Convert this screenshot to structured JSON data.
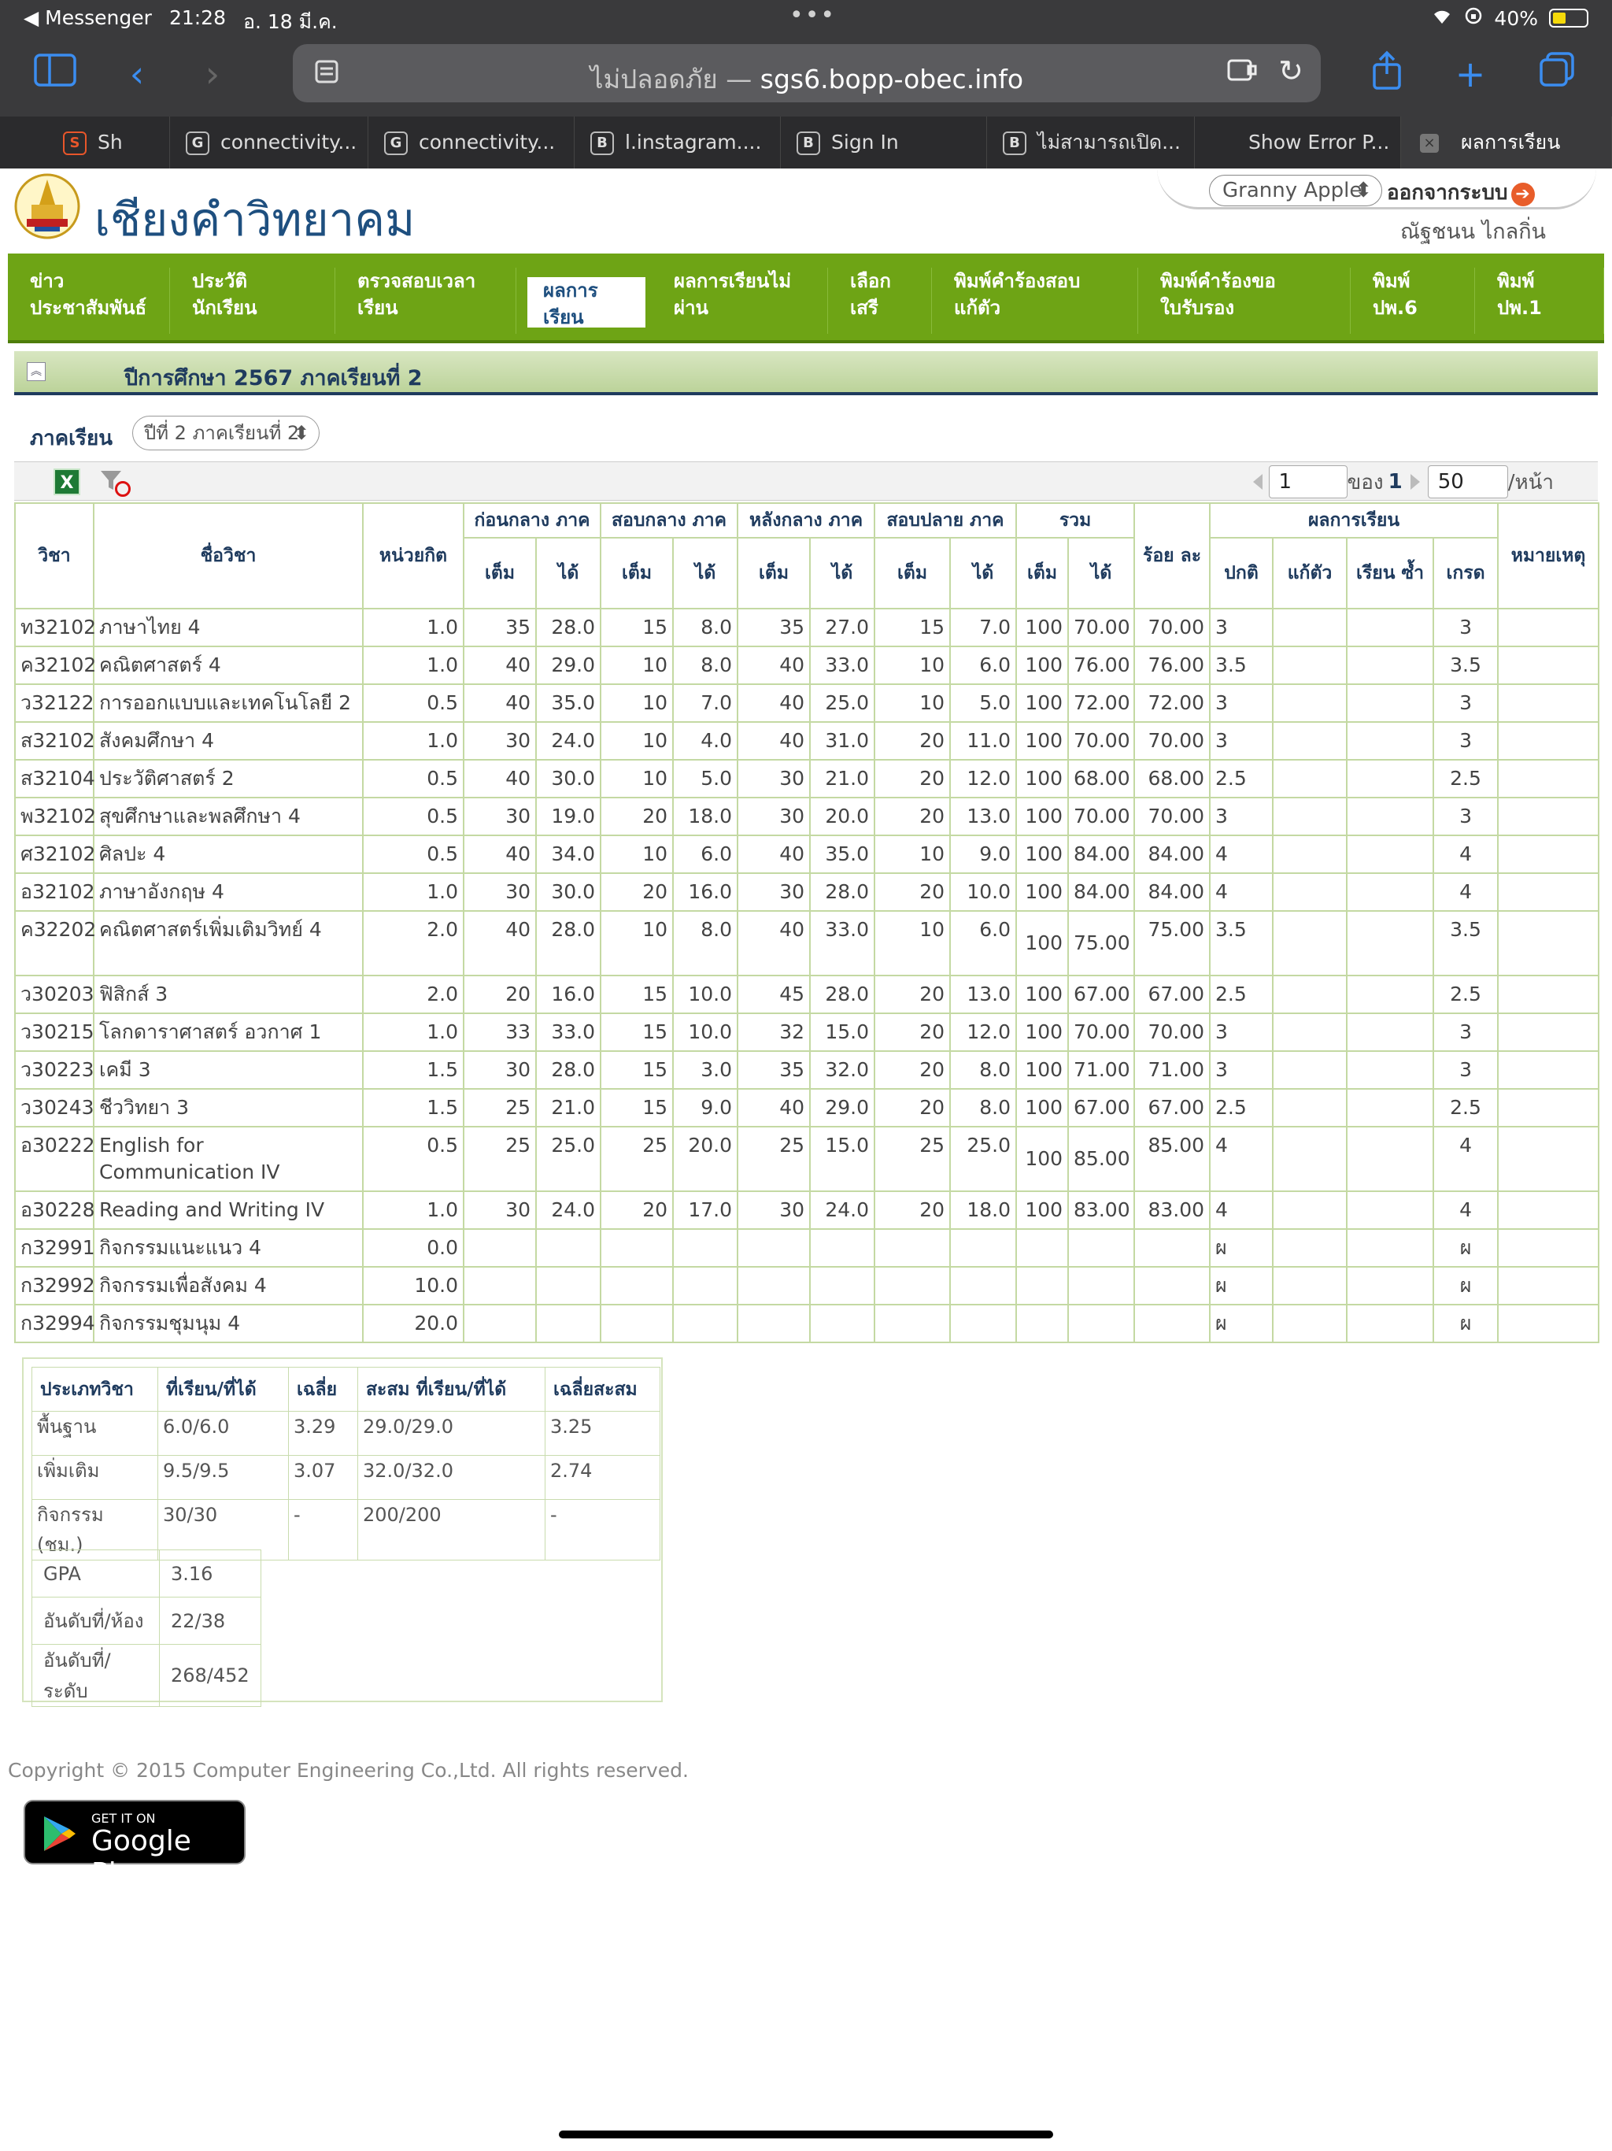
{
  "status_bar": {
    "back_app": "◀ Messenger",
    "time": "21:28",
    "date": "อ. 18 มี.ค.",
    "dots": "•••",
    "battery": "40%"
  },
  "browser": {
    "url_prefix": "ไม่ปลอดภัย — ",
    "url_host": "sgs6.bopp-obec.info",
    "tabs": [
      {
        "fav": "G",
        "label": "connectivity..."
      },
      {
        "fav": "G",
        "label": "connectivity..."
      },
      {
        "fav": "B",
        "label": "l.instagram...."
      },
      {
        "fav": "B",
        "label": "Sign In"
      },
      {
        "fav": "B",
        "label": "ไม่สามารถเปิด..."
      },
      {
        "fav": "",
        "label": "Show Error P..."
      },
      {
        "fav": "×",
        "label": "ผลการเรียน"
      }
    ],
    "first_tab_label": "Sh"
  },
  "site": {
    "title": "เชียงคำวิทยาคม",
    "user_select": "Granny Apple",
    "logout": "ออกจากระบบ",
    "user_name": "ณัฐชนน ไกลกิ่น"
  },
  "nav": [
    {
      "l1": "ข่าว",
      "l2": "ประชาสัมพันธ์"
    },
    {
      "l1": "ประวัติ",
      "l2": "นักเรียน"
    },
    {
      "l1": "ตรวจสอบเวลา",
      "l2": "เรียน"
    },
    {
      "l1": "ผลการ",
      "l2": "เรียน"
    },
    {
      "l1": "ผลการเรียนไม่",
      "l2": "ผ่าน"
    },
    {
      "l1": "เลือก",
      "l2": "เสรี"
    },
    {
      "l1": "พิมพ์คำร้องสอบ",
      "l2": "แก้ตัว"
    },
    {
      "l1": "พิมพ์คำร้องขอ",
      "l2": "ใบรับรอง"
    },
    {
      "l1": "พิมพ์",
      "l2": "ปพ.6"
    },
    {
      "l1": "พิมพ์",
      "l2": "ปพ.1"
    }
  ],
  "year_title": "ปีการศึกษา 2567 ภาคเรียนที่ 2",
  "term": {
    "label": "ภาคเรียน",
    "value": "ปีที่ 2 ภาคเรียนที่ 2"
  },
  "pager": {
    "page": "1",
    "of_label": "ของ",
    "total": "1",
    "per_page": "50",
    "per_label": "/หน้า"
  },
  "headers": {
    "code": "วิชา",
    "name": "ชื่อวิชา",
    "credit": "หน่วยกิต",
    "pre_mid": "ก่อนกลาง ภาค",
    "mid": "สอบกลาง ภาค",
    "post_mid": "หลังกลาง ภาค",
    "final": "สอบปลาย ภาค",
    "total": "รวม",
    "percent": "ร้อย ละ",
    "result": "ผลการเรียน",
    "remark": "หมายเหตุ",
    "full": "เต็ม",
    "got": "ได้",
    "normal": "ปกติ",
    "fix": "แก้ตัว",
    "repeat": "เรียน ซ้ำ",
    "grade": "เกรด"
  },
  "rows": [
    [
      "ท32102",
      "ภาษาไทย 4",
      "1.0",
      "35",
      "28.0",
      "15",
      "8.0",
      "35",
      "27.0",
      "15",
      "7.0",
      "100",
      "70.00",
      "70.00",
      "3",
      "",
      "",
      "3",
      ""
    ],
    [
      "ค32102",
      "คณิตศาสตร์ 4",
      "1.0",
      "40",
      "29.0",
      "10",
      "8.0",
      "40",
      "33.0",
      "10",
      "6.0",
      "100",
      "76.00",
      "76.00",
      "3.5",
      "",
      "",
      "3.5",
      ""
    ],
    [
      "ว32122",
      "การออกแบบและเทคโนโลยี 2",
      "0.5",
      "40",
      "35.0",
      "10",
      "7.0",
      "40",
      "25.0",
      "10",
      "5.0",
      "100",
      "72.00",
      "72.00",
      "3",
      "",
      "",
      "3",
      ""
    ],
    [
      "ส32102",
      "สังคมศึกษา 4",
      "1.0",
      "30",
      "24.0",
      "10",
      "4.0",
      "40",
      "31.0",
      "20",
      "11.0",
      "100",
      "70.00",
      "70.00",
      "3",
      "",
      "",
      "3",
      ""
    ],
    [
      "ส32104",
      "ประวัติศาสตร์ 2",
      "0.5",
      "40",
      "30.0",
      "10",
      "5.0",
      "30",
      "21.0",
      "20",
      "12.0",
      "100",
      "68.00",
      "68.00",
      "2.5",
      "",
      "",
      "2.5",
      ""
    ],
    [
      "พ32102",
      "สุขศึกษาและพลศึกษา 4",
      "0.5",
      "30",
      "19.0",
      "20",
      "18.0",
      "30",
      "20.0",
      "20",
      "13.0",
      "100",
      "70.00",
      "70.00",
      "3",
      "",
      "",
      "3",
      ""
    ],
    [
      "ศ32102",
      "ศิลปะ 4",
      "0.5",
      "40",
      "34.0",
      "10",
      "6.0",
      "40",
      "35.0",
      "10",
      "9.0",
      "100",
      "84.00",
      "84.00",
      "4",
      "",
      "",
      "4",
      ""
    ],
    [
      "อ32102",
      "ภาษาอังกฤษ 4",
      "1.0",
      "30",
      "30.0",
      "20",
      "16.0",
      "30",
      "28.0",
      "20",
      "10.0",
      "100",
      "84.00",
      "84.00",
      "4",
      "",
      "",
      "4",
      ""
    ],
    [
      "ค32202",
      "คณิตศาสตร์เพิ่มเติมวิทย์ 4",
      "2.0",
      "40",
      "28.0",
      "10",
      "8.0",
      "40",
      "33.0",
      "10",
      "6.0",
      "100",
      "75.00",
      "75.00",
      "3.5",
      "",
      "",
      "3.5",
      ""
    ],
    [
      "ว30203",
      "ฟิสิกส์ 3",
      "2.0",
      "20",
      "16.0",
      "15",
      "10.0",
      "45",
      "28.0",
      "20",
      "13.0",
      "100",
      "67.00",
      "67.00",
      "2.5",
      "",
      "",
      "2.5",
      ""
    ],
    [
      "ว30215",
      "โลกดาราศาสตร์ อวกาศ 1",
      "1.0",
      "33",
      "33.0",
      "15",
      "10.0",
      "32",
      "15.0",
      "20",
      "12.0",
      "100",
      "70.00",
      "70.00",
      "3",
      "",
      "",
      "3",
      ""
    ],
    [
      "ว30223",
      "เคมี 3",
      "1.5",
      "30",
      "28.0",
      "15",
      "3.0",
      "35",
      "32.0",
      "20",
      "8.0",
      "100",
      "71.00",
      "71.00",
      "3",
      "",
      "",
      "3",
      ""
    ],
    [
      "ว30243",
      "ชีววิทยา 3",
      "1.5",
      "25",
      "21.0",
      "15",
      "9.0",
      "40",
      "29.0",
      "20",
      "8.0",
      "100",
      "67.00",
      "67.00",
      "2.5",
      "",
      "",
      "2.5",
      ""
    ],
    [
      "อ30222",
      "English for Communication IV",
      "0.5",
      "25",
      "25.0",
      "25",
      "20.0",
      "25",
      "15.0",
      "25",
      "25.0",
      "100",
      "85.00",
      "85.00",
      "4",
      "",
      "",
      "4",
      ""
    ],
    [
      "อ30228",
      "Reading and Writing IV",
      "1.0",
      "30",
      "24.0",
      "20",
      "17.0",
      "30",
      "24.0",
      "20",
      "18.0",
      "100",
      "83.00",
      "83.00",
      "4",
      "",
      "",
      "4",
      ""
    ],
    [
      "ก32991",
      "กิจกรรมแนะแนว 4",
      "0.0",
      "",
      "",
      "",
      "",
      "",
      "",
      "",
      "",
      "",
      "",
      "",
      "ผ",
      "",
      "",
      "ผ",
      ""
    ],
    [
      "ก32992",
      "กิจกรรมเพื่อสังคม 4",
      "10.0",
      "",
      "",
      "",
      "",
      "",
      "",
      "",
      "",
      "",
      "",
      "",
      "ผ",
      "",
      "",
      "ผ",
      ""
    ],
    [
      "ก32994",
      "กิจกรรมชุมนุม 4",
      "20.0",
      "",
      "",
      "",
      "",
      "",
      "",
      "",
      "",
      "",
      "",
      "",
      "ผ",
      "",
      "",
      "ผ",
      ""
    ]
  ],
  "summary": {
    "headers": [
      "ประเภทวิชา",
      "ที่เรียน/ที่ได้",
      "เฉลี่ย",
      "สะสม ที่เรียน/ที่ได้",
      "เฉลี่ยสะสม"
    ],
    "rows": [
      [
        "พื้นฐาน",
        "6.0/6.0",
        "3.29",
        "29.0/29.0",
        "3.25"
      ],
      [
        "เพิ่มเติม",
        "9.5/9.5",
        "3.07",
        "32.0/32.0",
        "2.74"
      ],
      [
        "กิจกรรม (ชม.)",
        "30/30",
        "-",
        "200/200",
        "-"
      ]
    ],
    "gpa": [
      [
        "GPA",
        "3.16"
      ],
      [
        "อันดับที่/ห้อง",
        "22/38"
      ],
      [
        "อันดับที่/ระดับ",
        "268/452"
      ]
    ]
  },
  "footer": {
    "copyright": "Copyright © 2015 Computer Engineering Co.,Ltd. All rights reserved.",
    "gplay_small": "GET IT ON",
    "gplay_big": "Google Play"
  }
}
